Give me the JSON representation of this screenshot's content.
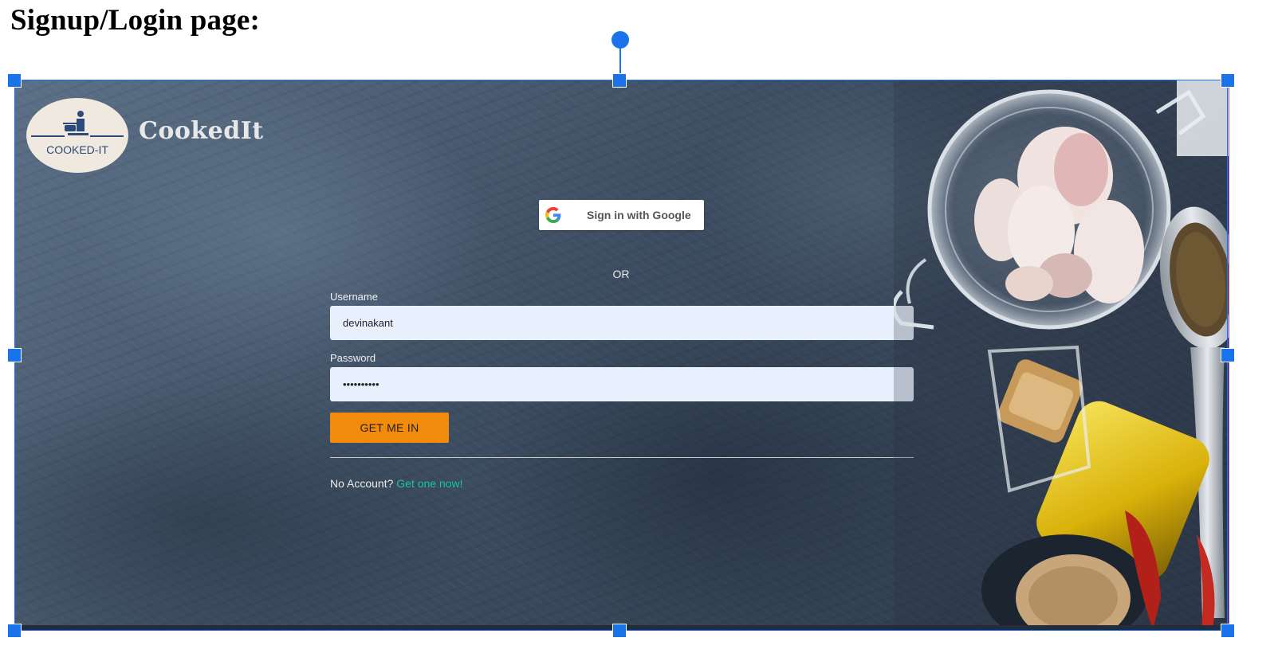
{
  "document": {
    "heading": "Signup/Login page:"
  },
  "app": {
    "logo_text": "COOKED-IT",
    "brand_name": "CookedIt"
  },
  "google_signin": {
    "label": "Sign in with Google"
  },
  "separator": {
    "text": "OR"
  },
  "login_form": {
    "username_label": "Username",
    "username_value": "devinakant",
    "password_label": "Password",
    "password_value": "••••••••••",
    "submit_label": "GET ME IN"
  },
  "signup": {
    "prompt": "No Account?",
    "link_text": "Get one now!"
  },
  "colors": {
    "accent": "#f28a0c",
    "link": "#18c59a",
    "input_background": "#e8f0fe",
    "selection": "#1a73e8"
  },
  "icons": [
    "google-g-icon",
    "logo-emblem-icon"
  ]
}
